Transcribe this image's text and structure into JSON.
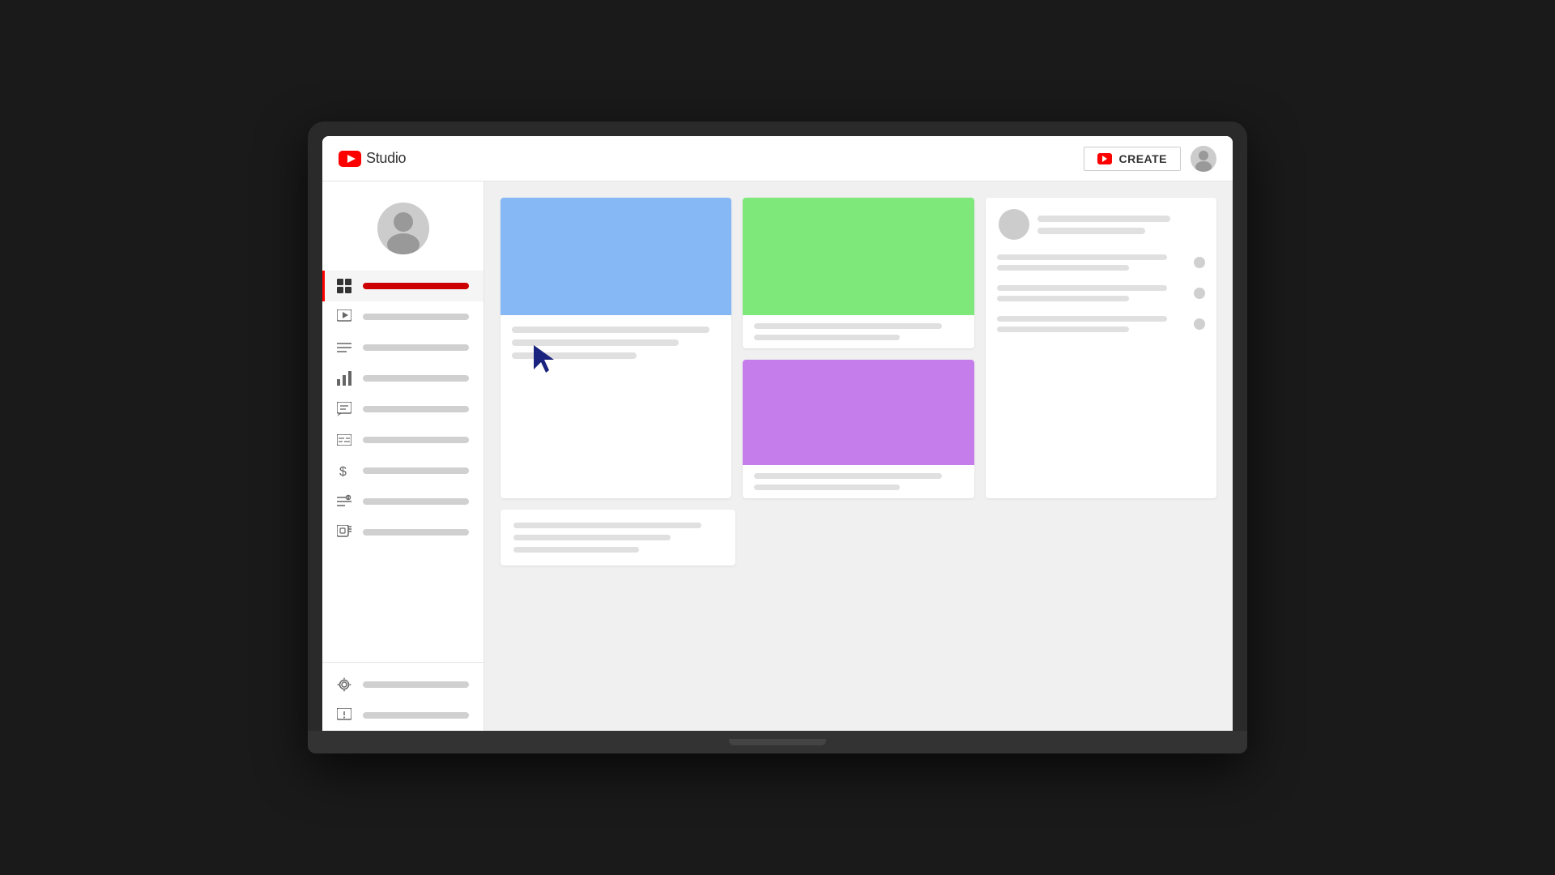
{
  "header": {
    "logo_text": "Studio",
    "create_label": "CREATE",
    "create_aria": "Create button"
  },
  "sidebar": {
    "nav_items": [
      {
        "id": "dashboard",
        "icon": "grid",
        "active": true
      },
      {
        "id": "content",
        "icon": "video",
        "active": false
      },
      {
        "id": "playlists",
        "icon": "list",
        "active": false
      },
      {
        "id": "analytics",
        "icon": "bar-chart",
        "active": false
      },
      {
        "id": "comments",
        "icon": "comment",
        "active": false
      },
      {
        "id": "subtitles",
        "icon": "subtitles",
        "active": false
      },
      {
        "id": "monetization",
        "icon": "dollar",
        "active": false
      },
      {
        "id": "customization",
        "icon": "edit",
        "active": false
      },
      {
        "id": "audio",
        "icon": "audio-library",
        "active": false
      }
    ],
    "bottom_items": [
      {
        "id": "settings",
        "icon": "gear"
      },
      {
        "id": "feedback",
        "icon": "feedback"
      }
    ]
  },
  "cards": {
    "card1": {
      "thumbnail_color": "blue",
      "has_cursor": true
    },
    "card2": {
      "thumbnail_color": "green"
    },
    "card3_profile": {
      "has_avatar": true
    },
    "card4_text_only": {},
    "card5_thumbnail_color": "purple",
    "card6_list": {}
  },
  "colors": {
    "red": "#ff0000",
    "blue_thumb": "#85b8f5",
    "green_thumb": "#7ee87a",
    "purple_thumb": "#c47deb",
    "sidebar_active": "#ff0000",
    "cursor_color": "#1a237e"
  }
}
